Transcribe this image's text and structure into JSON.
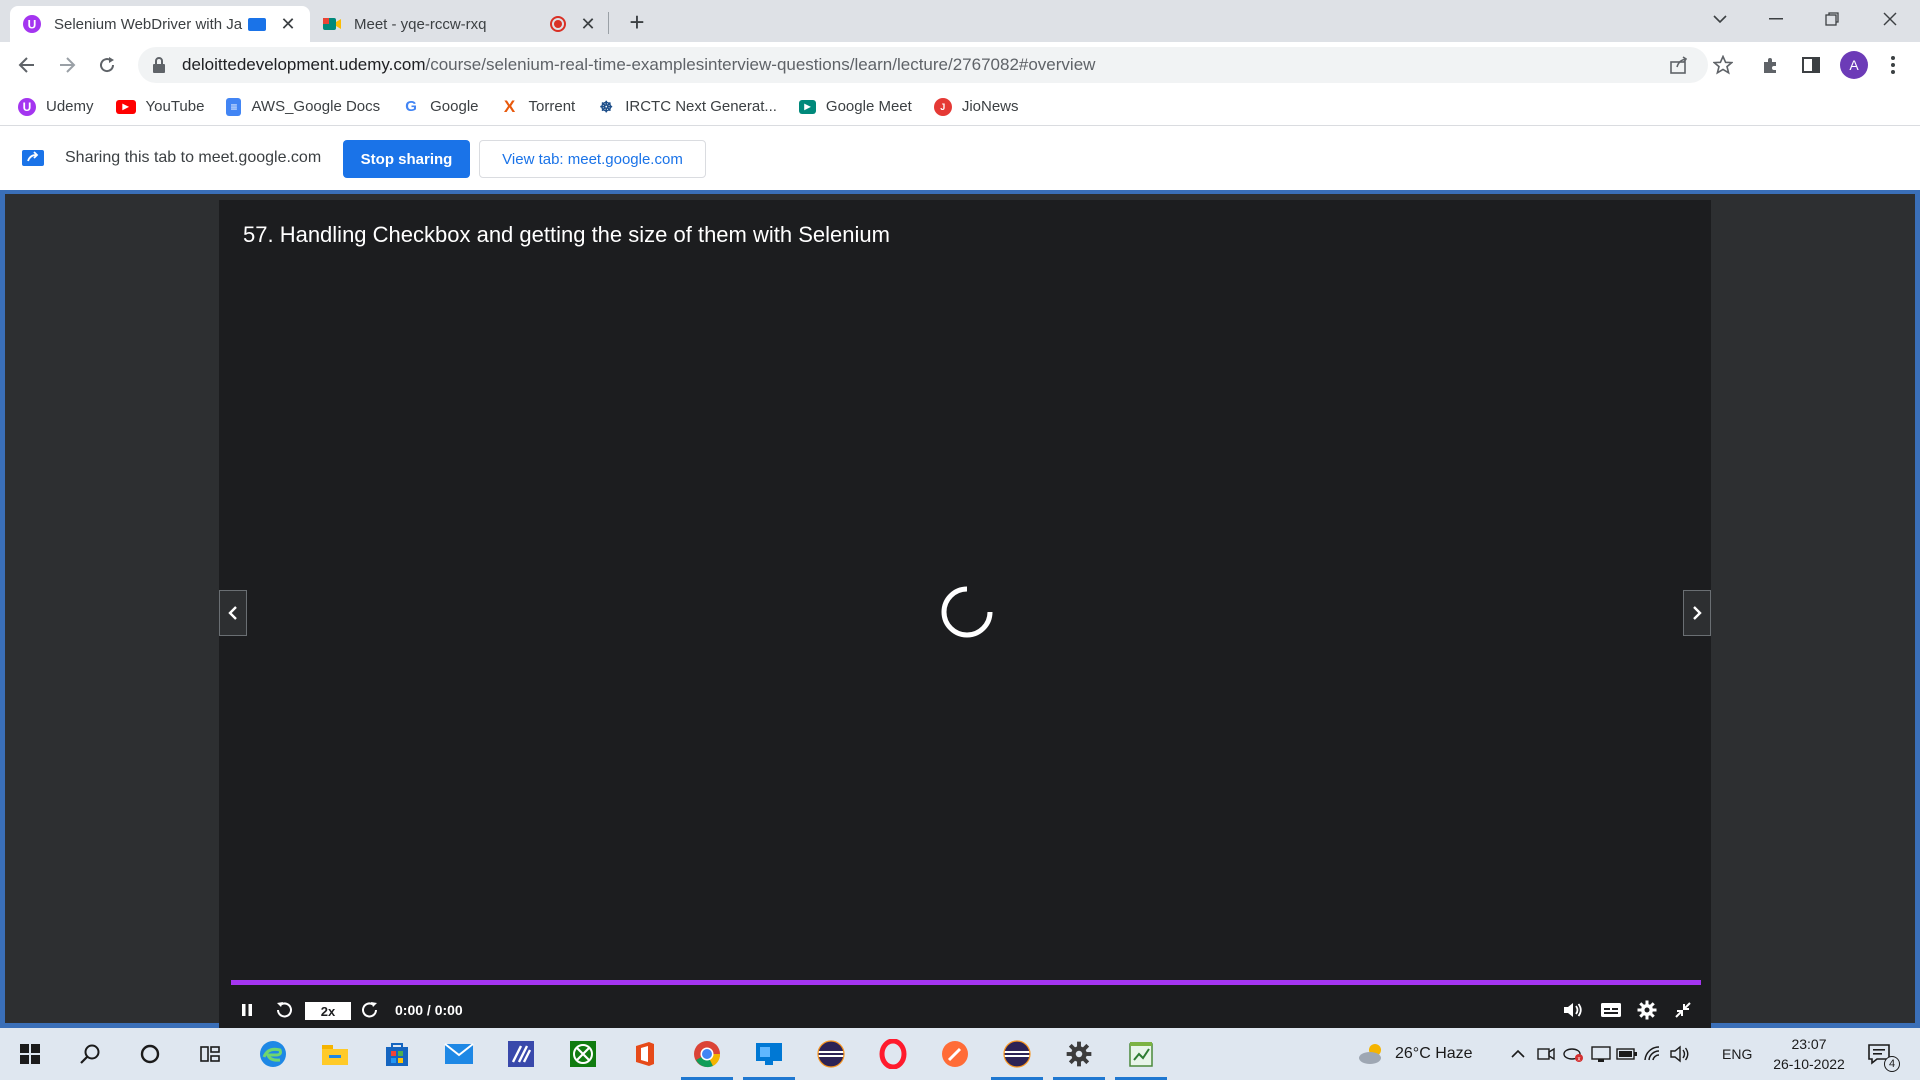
{
  "browser": {
    "tabs": [
      {
        "title": "Selenium WebDriver with Ja",
        "active": true
      },
      {
        "title": "Meet - yqe-rccw-rxq",
        "active": false
      }
    ],
    "url_host": "deloittedevelopment.udemy.com",
    "url_path": "/course/selenium-real-time-examplesinterview-questions/learn/lecture/2767082#overview",
    "profile_initial": "A",
    "bookmarks": [
      {
        "label": "Udemy",
        "icon": "udemy-icon",
        "color": "#a435f0"
      },
      {
        "label": "YouTube",
        "icon": "youtube-icon",
        "color": "#ff0000"
      },
      {
        "label": "AWS_Google Docs",
        "icon": "docs-icon",
        "color": "#4285f4"
      },
      {
        "label": "Google",
        "icon": "google-icon",
        "color": "#4285f4"
      },
      {
        "label": "Torrent",
        "icon": "torrent-icon",
        "color": "#e8590c"
      },
      {
        "label": "IRCTC Next Generat...",
        "icon": "irctc-icon",
        "color": "#1d4e89"
      },
      {
        "label": "Google Meet",
        "icon": "meet-icon",
        "color": "#00897b"
      },
      {
        "label": "JioNews",
        "icon": "jionews-icon",
        "color": "#e53935"
      }
    ]
  },
  "sharing": {
    "text": "Sharing this tab to meet.google.com",
    "stop_label": "Stop sharing",
    "view_label": "View tab: meet.google.com"
  },
  "player": {
    "lecture_title": "57. Handling Checkbox and getting the size of them with Selenium",
    "speed": "2x",
    "time": "0:00 / 0:00",
    "accent": "#a435f0"
  },
  "taskbar": {
    "weather": "26°C  Haze",
    "language": "ENG",
    "time": "23:07",
    "date": "26-10-2022",
    "notification_count": "4"
  }
}
